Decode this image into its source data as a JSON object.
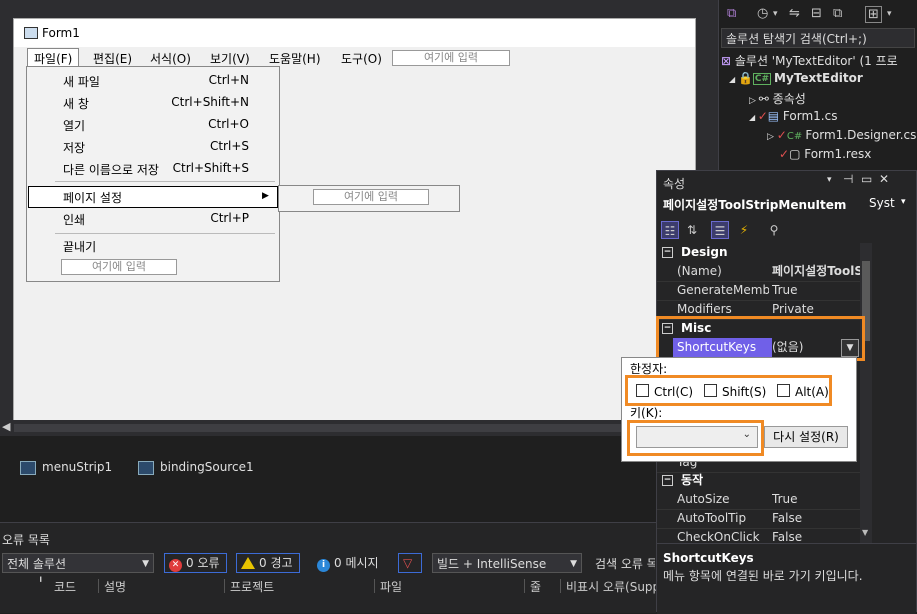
{
  "form": {
    "title": "Form1",
    "menus": [
      "파일(F)",
      "편집(E)",
      "서식(O)",
      "보기(V)",
      "도움말(H)",
      "도구(O)"
    ],
    "type_here": "여기에 입력"
  },
  "file_menu": {
    "items": [
      {
        "label": "새 파일",
        "shortcut": "Ctrl+N"
      },
      {
        "label": "새 창",
        "shortcut": "Ctrl+Shift+N"
      },
      {
        "label": "열기",
        "shortcut": "Ctrl+O"
      },
      {
        "label": "저장",
        "shortcut": "Ctrl+S"
      },
      {
        "label": "다른 이름으로 저장",
        "shortcut": "Ctrl+Shift+S"
      },
      {
        "label": "페이지 설정",
        "shortcut": ""
      },
      {
        "label": "인쇄",
        "shortcut": "Ctrl+P"
      },
      {
        "label": "끝내기",
        "shortcut": ""
      }
    ],
    "submenu_arrow": "▶"
  },
  "tray": {
    "items": [
      "menuStrip1",
      "bindingSource1"
    ]
  },
  "error_list": {
    "title": "오류 목록",
    "scope": "전체 솔루션",
    "errors": "0 오류",
    "warnings": "0 경고",
    "messages": "0 메시지",
    "source": "빌드 + IntelliSense",
    "search": "검색 오류 목",
    "columns": [
      "코드",
      "설명",
      "프로젝트",
      "파일",
      "줄",
      "비표시 오류(Supp"
    ]
  },
  "solution_explorer": {
    "search_placeholder": "솔루션 탐색기 검색(Ctrl+;)",
    "solution_label": "솔루션 'MyTextEditor' (1 프로",
    "project": "MyTextEditor",
    "dependencies": "종속성",
    "files": [
      "Form1.cs",
      "Form1.Designer.cs",
      "Form1.resx"
    ]
  },
  "properties": {
    "header": "속성",
    "object_name": "페이지설정ToolStripMenuItem",
    "object_type": "Syst",
    "categories": {
      "design": "Design",
      "misc": "Misc",
      "behavior": "동작"
    },
    "design_rows": [
      {
        "name": "(Name)",
        "value": "페이지설정ToolS"
      },
      {
        "name": "GenerateMember",
        "value": "True"
      },
      {
        "name": "Modifiers",
        "value": "Private"
      }
    ],
    "shortcut_row": {
      "name": "ShortcutKeys",
      "value": "(없음)"
    },
    "tag_row": "Tag",
    "behavior_rows": [
      {
        "name": "AutoSize",
        "value": "True"
      },
      {
        "name": "AutoToolTip",
        "value": "False"
      },
      {
        "name": "CheckOnClick",
        "value": "False"
      }
    ],
    "description_title": "ShortcutKeys",
    "description_text": "메뉴 항목에 연결된 바로 가기 키입니다."
  },
  "shortcut_editor": {
    "modifiers_label": "한정자:",
    "ctrl": "Ctrl(C)",
    "shift": "Shift(S)",
    "alt": "Alt(A)",
    "key_label": "키(K):",
    "key_value": "",
    "reset_button": "다시 설정(R)"
  },
  "colors": {
    "highlight": "#f08a24",
    "selected_row": "#7060e8"
  }
}
